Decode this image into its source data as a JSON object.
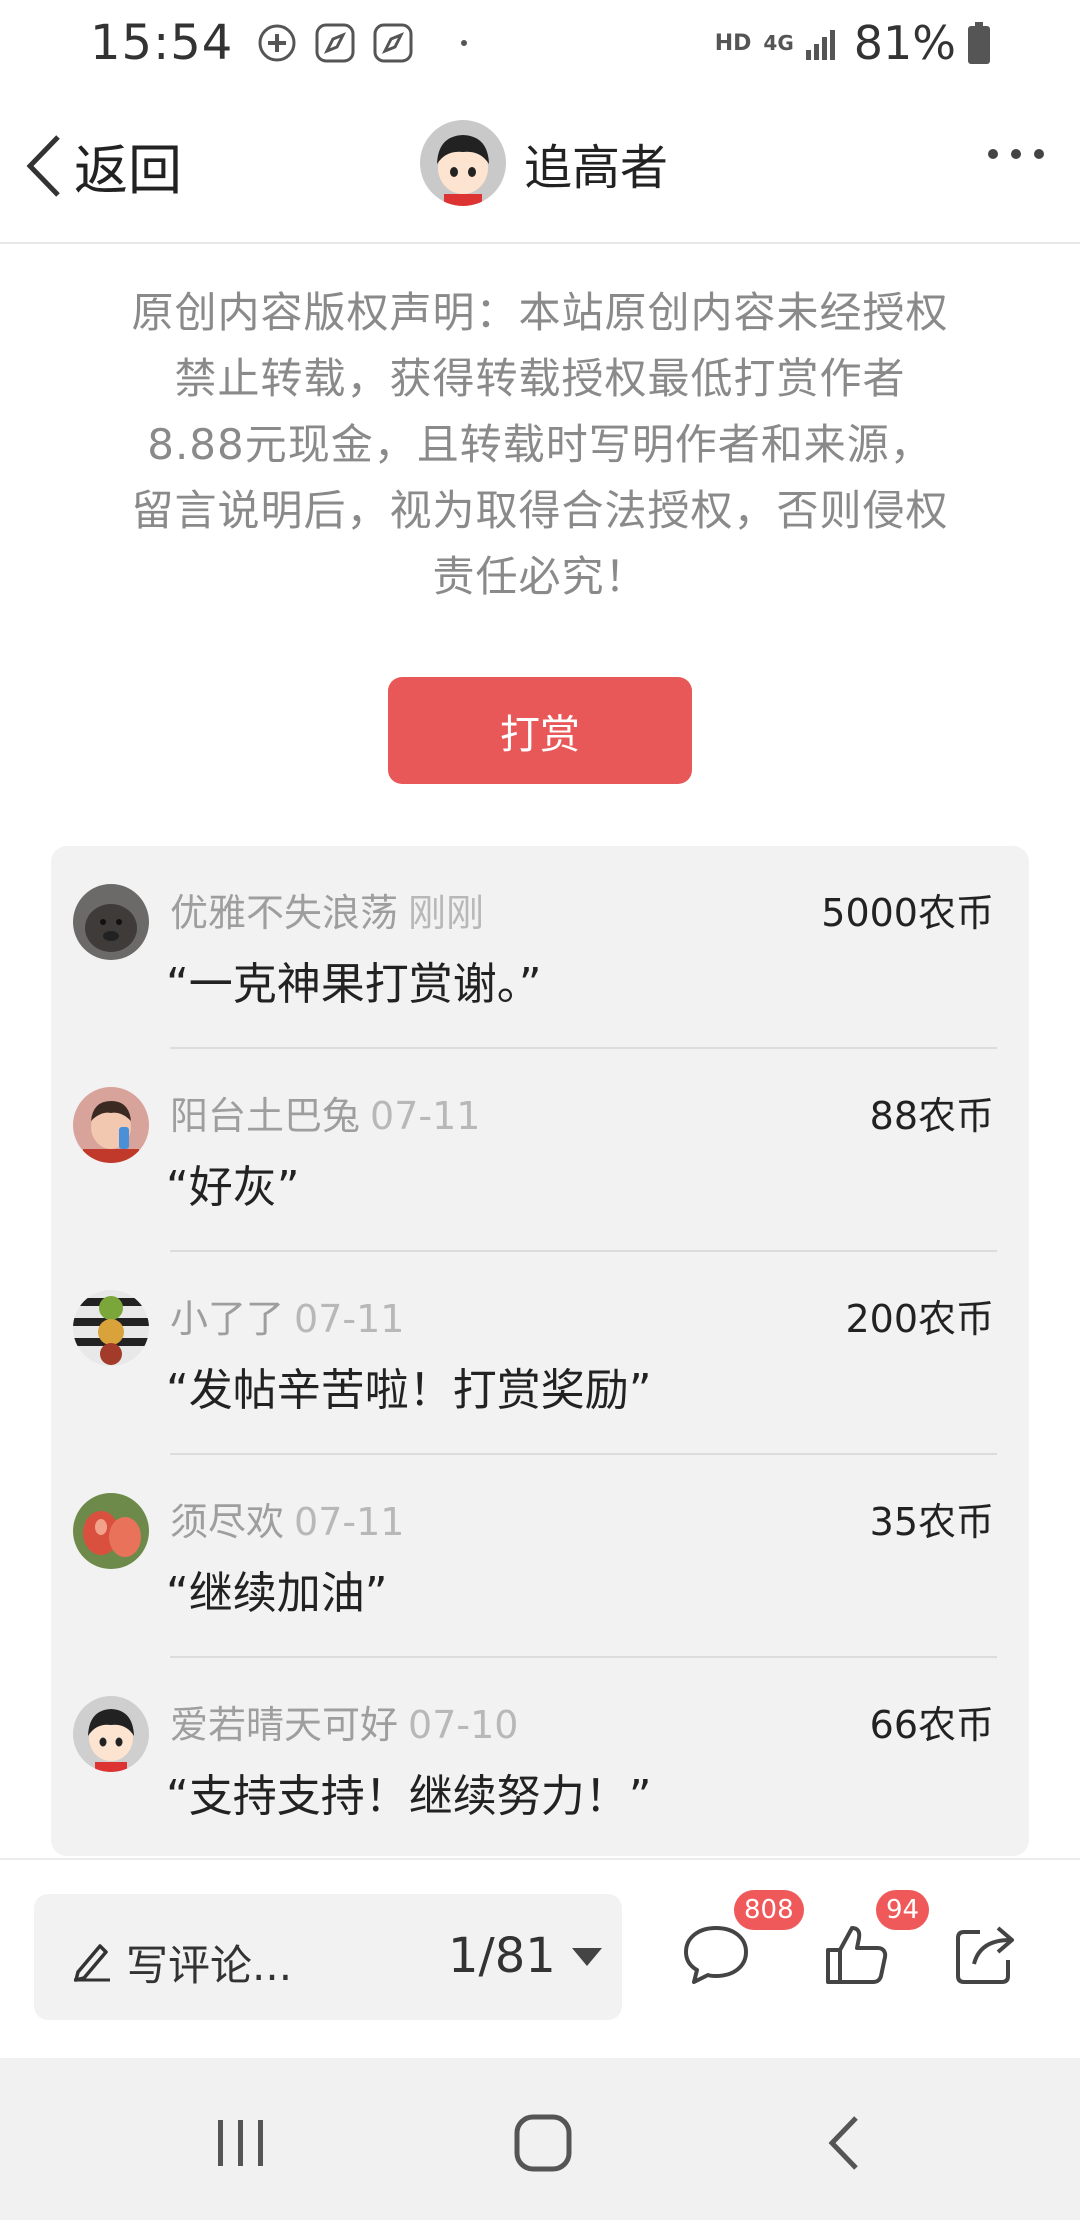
{
  "status_bar": {
    "time": "15:54",
    "hd": "HD",
    "network": "4G",
    "battery": "81%"
  },
  "header": {
    "back_label": "返回",
    "author_name": "追高者"
  },
  "notice": {
    "text": "原创内容版权声明：本站原创内容未经授权禁止转载，获得转载授权最低打赏作者8.88元现金，且转载时写明作者和来源，留言说明后，视为取得合法授权，否则侵权责任必究！"
  },
  "tip_button": {
    "label": "打赏"
  },
  "tips": [
    {
      "user": "优雅不失浪荡",
      "time": "刚刚",
      "amount": "5000农币",
      "message": "“一克神果打赏谢。”"
    },
    {
      "user": "阳台土巴兔",
      "time": "07-11",
      "amount": "88农币",
      "message": "“好灰”"
    },
    {
      "user": "小了了",
      "time": "07-11",
      "amount": "200农币",
      "message": "“发帖辛苦啦！打赏奖励”"
    },
    {
      "user": "须尽欢",
      "time": "07-11",
      "amount": "35农币",
      "message": "“继续加油”"
    },
    {
      "user": "爱若晴天可好",
      "time": "07-10",
      "amount": "66农币",
      "message": "“支持支持！继续努力！”"
    }
  ],
  "action_bar": {
    "comment_placeholder": "写评论...",
    "page_indicator": "1/81",
    "comment_count": "808",
    "like_count": "94"
  },
  "colors": {
    "accent": "#e85858",
    "badge": "#f0595a",
    "panel_bg": "#f2f2f2"
  }
}
